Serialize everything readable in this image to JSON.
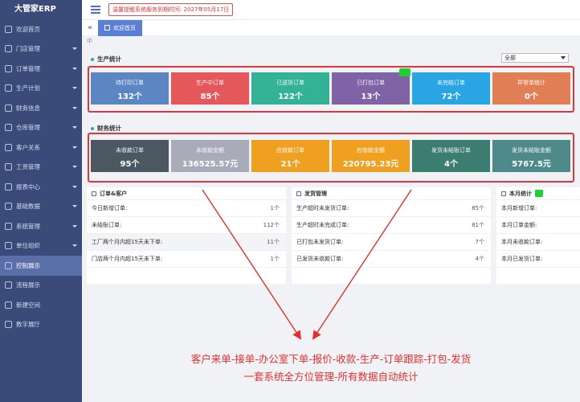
{
  "app_title": "大管家ERP",
  "sidebar": {
    "items": [
      {
        "label": "欢迎首页",
        "caret": false,
        "active": false
      },
      {
        "label": "门店管理",
        "caret": true,
        "active": false
      },
      {
        "label": "订单管理",
        "caret": true,
        "active": false
      },
      {
        "label": "生产计划",
        "caret": true,
        "active": false
      },
      {
        "label": "财务信息",
        "caret": true,
        "active": false
      },
      {
        "label": "仓库管理",
        "caret": true,
        "active": false
      },
      {
        "label": "客户关系",
        "caret": true,
        "active": false
      },
      {
        "label": "工资管理",
        "caret": true,
        "active": false
      },
      {
        "label": "报表中心",
        "caret": true,
        "active": false
      },
      {
        "label": "基础数据",
        "caret": true,
        "active": false
      },
      {
        "label": "系统管理",
        "caret": true,
        "active": false
      },
      {
        "label": "单位组织",
        "caret": true,
        "active": false
      },
      {
        "label": "控制展示",
        "caret": false,
        "active": true
      },
      {
        "label": "流程展示",
        "caret": false,
        "active": false
      },
      {
        "label": "新建空间",
        "caret": false,
        "active": false
      },
      {
        "label": "数字展厅",
        "caret": false,
        "active": false
      }
    ]
  },
  "topbar": {
    "notice": "温馨提醒系统服务到期时间: 2027年05月17日"
  },
  "tabs": {
    "collapse_glyph": "«",
    "home_label": "欢迎首页"
  },
  "corner_mark": "中",
  "production": {
    "title": "生产统计",
    "select_value": "全部",
    "cards": [
      {
        "label": "待打印订单",
        "value": "132个",
        "color": "#5b86c2"
      },
      {
        "label": "生产中订单",
        "value": "85个",
        "color": "#e4585b"
      },
      {
        "label": "已送货订单",
        "value": "122个",
        "color": "#33b296"
      },
      {
        "label": "已打包订单",
        "value": "13个",
        "color": "#7f63a6"
      },
      {
        "label": "未完结订单",
        "value": "72个",
        "color": "#2aa5e4"
      },
      {
        "label": "异常单统计",
        "value": "0个",
        "color": "#e07f55"
      }
    ]
  },
  "finance": {
    "title": "财务统计",
    "cards": [
      {
        "label": "未收款订单",
        "value": "95个",
        "color": "#4b5862"
      },
      {
        "label": "未收款金额",
        "value": "136525.57元",
        "color": "#a9acb8"
      },
      {
        "label": "应收款订单",
        "value": "21个",
        "color": "#f0a020"
      },
      {
        "label": "应收款金额",
        "value": "220795.23元",
        "color": "#f0a020"
      },
      {
        "label": "发货未结账订单",
        "value": "4个",
        "color": "#3b7d70"
      },
      {
        "label": "发货未结账金额",
        "value": "5767.5元",
        "color": "#4f8a8a"
      }
    ]
  },
  "panels": {
    "orders": {
      "title": "订单&客户",
      "rows": [
        {
          "label": "今日新增订单:",
          "value": "1个"
        },
        {
          "label": "未结账订单:",
          "value": "112个"
        },
        {
          "label": "工厂两个月内超15天未下单:",
          "value": "11个"
        },
        {
          "label": "门店两个月内超15天未下单:",
          "value": "1个"
        }
      ]
    },
    "shipping": {
      "title": "发货管理",
      "rows": [
        {
          "label": "生产超时未发货订单:",
          "value": "85个"
        },
        {
          "label": "生产超时未完成订单:",
          "value": "81个"
        },
        {
          "label": "已打包未发货订单:",
          "value": "7个"
        },
        {
          "label": "已发货未收款订单:",
          "value": "4个"
        }
      ]
    },
    "monthly": {
      "title": "本月统计",
      "rows": [
        {
          "label": "本月新增订单:",
          "value": ""
        },
        {
          "label": "本月订单金额:",
          "value": ""
        },
        {
          "label": "本月未收款订单:",
          "value": ""
        },
        {
          "label": "本月已发货订单:",
          "value": ""
        }
      ]
    }
  },
  "annotation": {
    "line1": "客户来单-接单-办公室下单-报价-收款-生产-订单跟踪-打包-发货",
    "line2": "一套系统全方位管理-所有数据自动统计",
    "color": "#e0302f"
  }
}
